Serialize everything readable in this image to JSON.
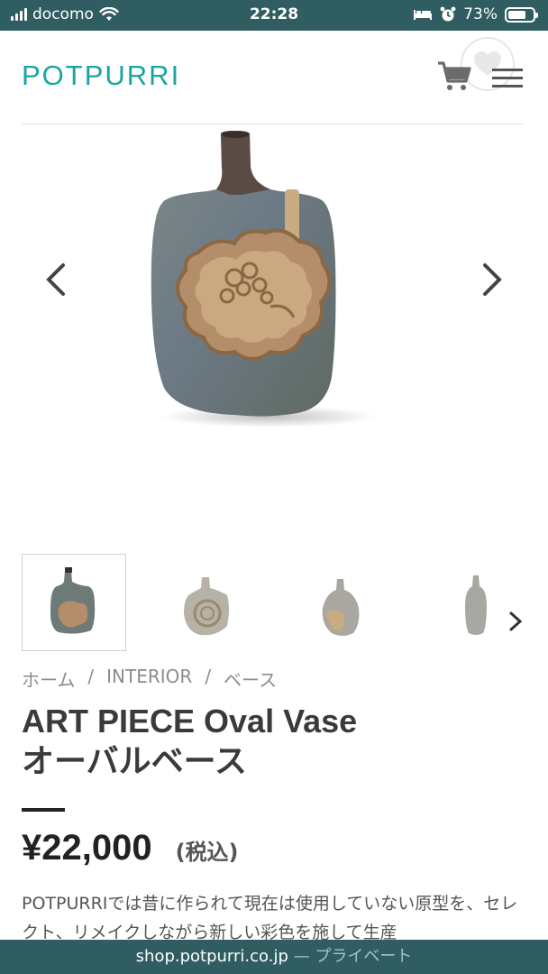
{
  "status_bar": {
    "carrier": "docomo",
    "time": "22:28",
    "battery": "73%",
    "battery_level": 0.73,
    "icons": [
      "signal-icon",
      "wifi-icon",
      "bed-icon",
      "alarm-icon",
      "battery-icon"
    ]
  },
  "header": {
    "logo": "POTPURRI",
    "icons": [
      "cart-icon",
      "favorite-icon",
      "menu-icon"
    ],
    "accent_color": "#1aa5a3"
  },
  "gallery": {
    "prev_icon": "chevron-left-icon",
    "next_icon": "chevron-right-icon",
    "thumbnail_count": 4,
    "active_thumbnail": 1
  },
  "breadcrumb": {
    "items": [
      "ホーム",
      "INTERIOR",
      "ベース"
    ],
    "separator": "/"
  },
  "product": {
    "title_line1": "ART PIECE Oval Vase",
    "title_line2": "オーバルベース",
    "price": "¥22,000",
    "tax_label": "(税込)",
    "description": "POTPURRIでは昔に作られて現在は使用していない原型を、セレクト、リメイクしながら新しい彩色を施して生産"
  },
  "url_bar": {
    "domain": "shop.potpurri.co.jp",
    "suffix": "— プライベート",
    "color": "#2f5d62"
  }
}
